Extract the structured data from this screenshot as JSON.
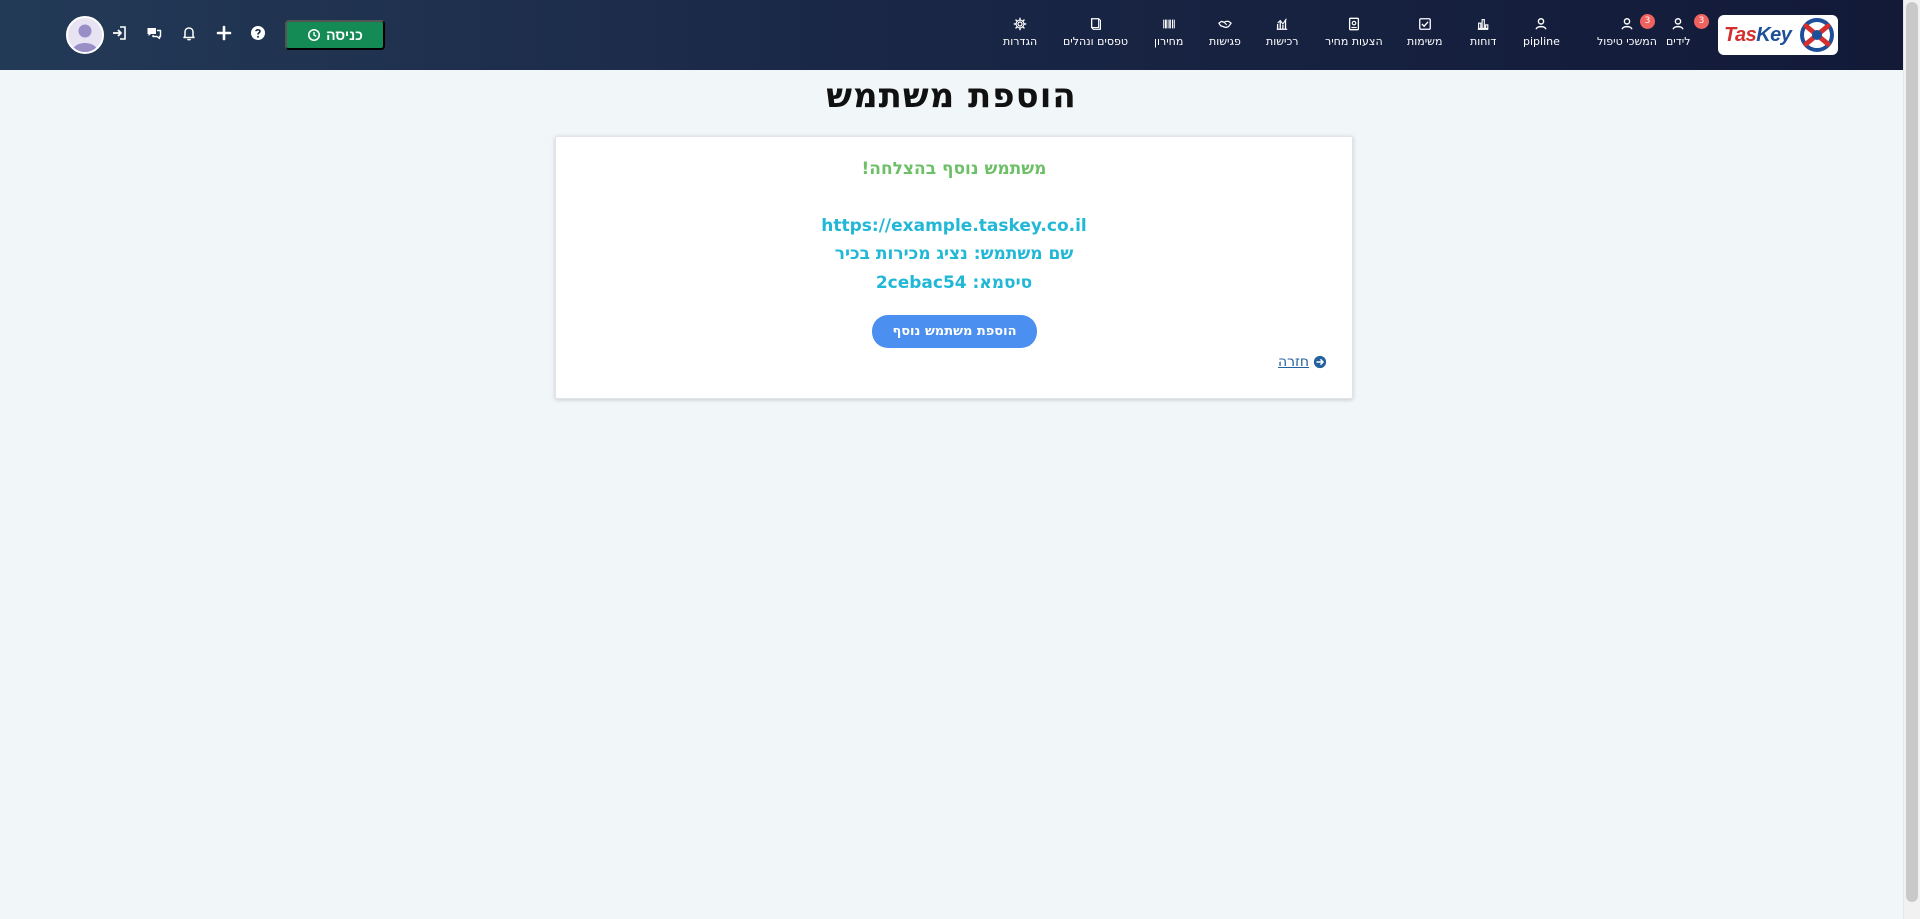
{
  "brand": {
    "logo_text_a": "Tas",
    "logo_text_b": "Key",
    "red": "#d32f2f",
    "blue": "#1e4f9a"
  },
  "nav": {
    "items": [
      {
        "label": "לידים",
        "icon": "user-icon",
        "badge": "3"
      },
      {
        "label": "המשכי טיפול",
        "icon": "user-icon",
        "badge": "3"
      },
      {
        "label": "pipline",
        "icon": "user-icon",
        "badge": ""
      },
      {
        "label": "דוחות",
        "icon": "bar-chart-icon",
        "badge": ""
      },
      {
        "label": "משימות",
        "icon": "checkbox-icon",
        "badge": ""
      },
      {
        "label": "הצעות מחיר",
        "icon": "document-icon",
        "badge": ""
      },
      {
        "label": "רכישות",
        "icon": "chart-icon",
        "badge": ""
      },
      {
        "label": "פגישות",
        "icon": "handshake-icon",
        "badge": ""
      },
      {
        "label": "מחירון",
        "icon": "barcode-icon",
        "badge": ""
      },
      {
        "label": "טפסים ונהלים",
        "icon": "book-icon",
        "badge": ""
      },
      {
        "label": "הגדרות",
        "icon": "gear-icon",
        "badge": ""
      }
    ]
  },
  "toolbar": {
    "checkin_label": "כניסה",
    "icons": [
      "help-icon",
      "plus-icon",
      "bell-icon",
      "chat-icon",
      "login-icon"
    ]
  },
  "page": {
    "title": "הוספת משתמש"
  },
  "result": {
    "success_message": "משתמש נוסף בהצלחה!",
    "url": "https://example.taskey.co.il",
    "username_line": "שם משתמש: נציג מכירות בכיר",
    "password_line": "סיסמא: 2cebac54",
    "add_another_label": "הוספת משתמש נוסף",
    "back_label": "חזרה"
  },
  "colors": {
    "nav_bg": "#1a2746",
    "checkin_green": "#148a55",
    "success_green": "#6dc067",
    "info_cyan": "#21b7d6",
    "button_blue": "#4b8ff0",
    "badge_red": "#f0625f"
  }
}
